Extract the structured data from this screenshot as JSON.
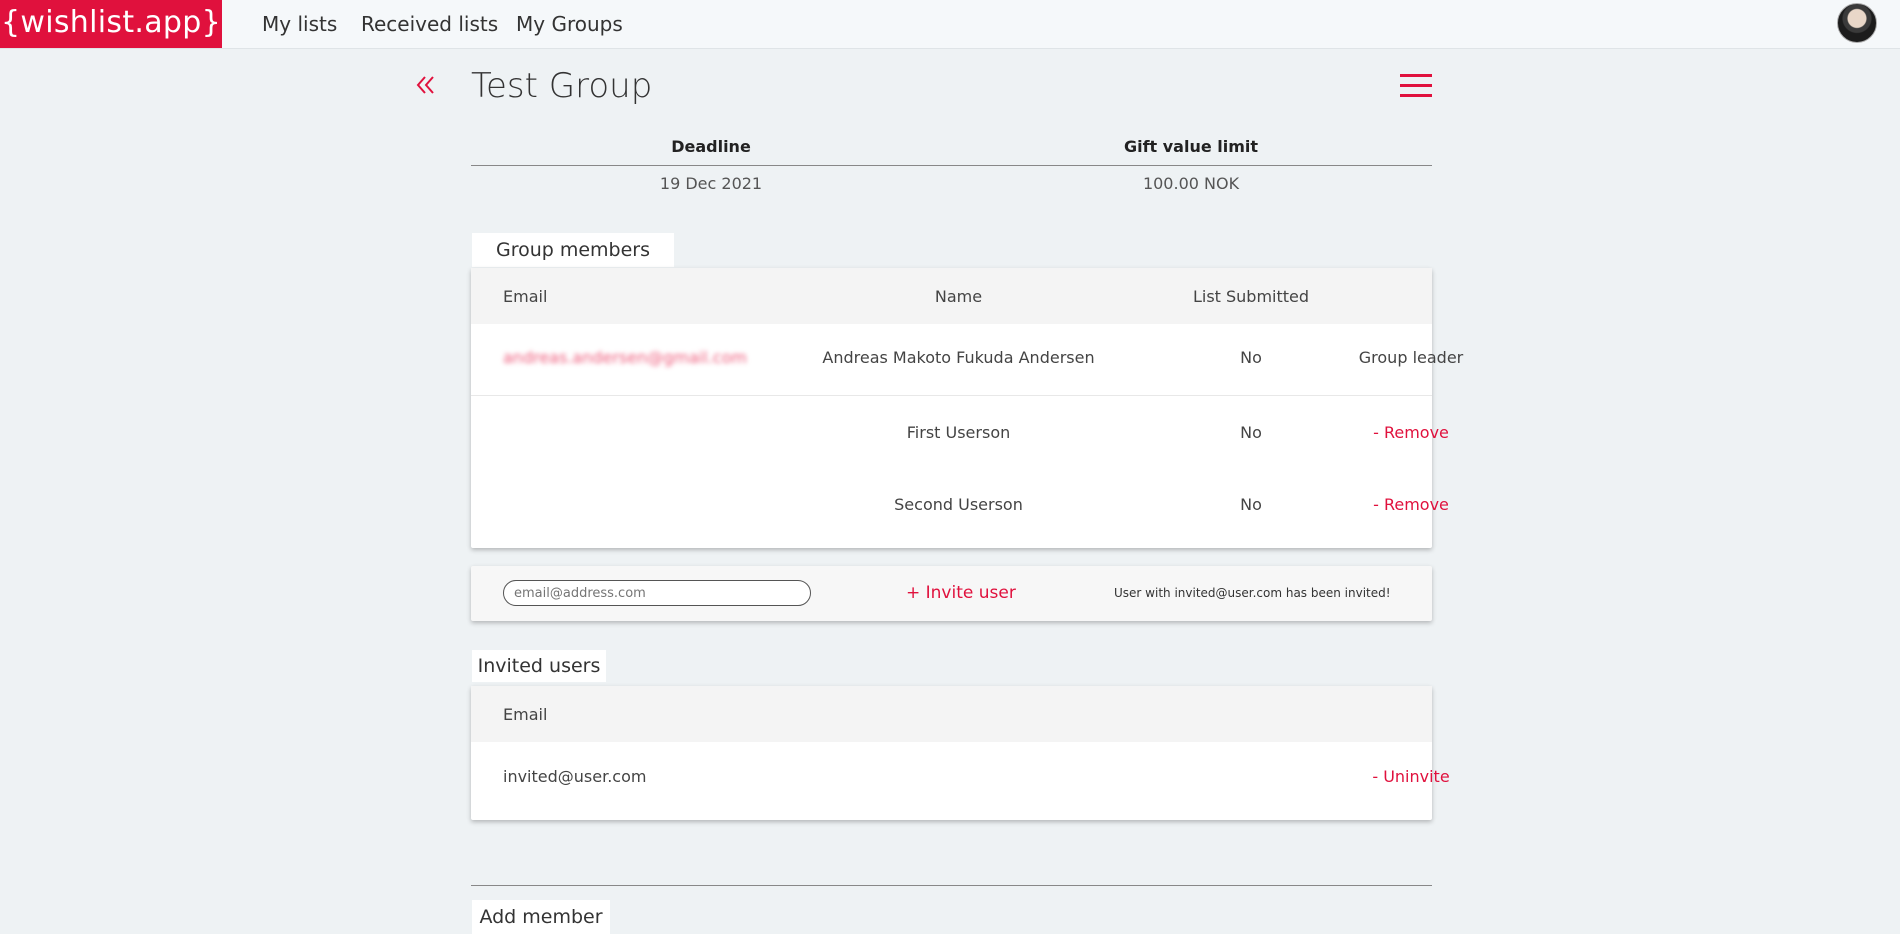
{
  "app": {
    "logo": "{wishlist.app}"
  },
  "nav": {
    "my_lists": "My lists",
    "received_lists": "Received lists",
    "my_groups": "My Groups"
  },
  "page": {
    "title": "Test Group"
  },
  "info": {
    "deadline_label": "Deadline",
    "gift_limit_label": "Gift value limit",
    "deadline_value": "19 Dec 2021",
    "gift_limit_value": "100.00 NOK"
  },
  "members": {
    "section_label": "Group members",
    "columns": {
      "email": "Email",
      "name": "Name",
      "submitted": "List Submitted"
    },
    "rows": [
      {
        "email": "andreas.andersen@gmail.com",
        "name": "Andreas Makoto Fukuda Andersen",
        "submitted": "No",
        "action": "Group leader"
      },
      {
        "email": "",
        "name": "First Userson",
        "submitted": "No",
        "action": "- Remove"
      },
      {
        "email": "",
        "name": "Second Userson",
        "submitted": "No",
        "action": "- Remove"
      }
    ]
  },
  "invite": {
    "placeholder": "email@address.com",
    "button": "+ Invite user",
    "status": "User with invited@user.com has been invited!"
  },
  "invited": {
    "section_label": "Invited users",
    "columns": {
      "email": "Email"
    },
    "rows": [
      {
        "email": "invited@user.com",
        "action": "- Uninvite"
      }
    ]
  },
  "add_member": {
    "section_label": "Add member"
  },
  "colors": {
    "accent": "#e0113d",
    "background": "#eef2f4"
  }
}
